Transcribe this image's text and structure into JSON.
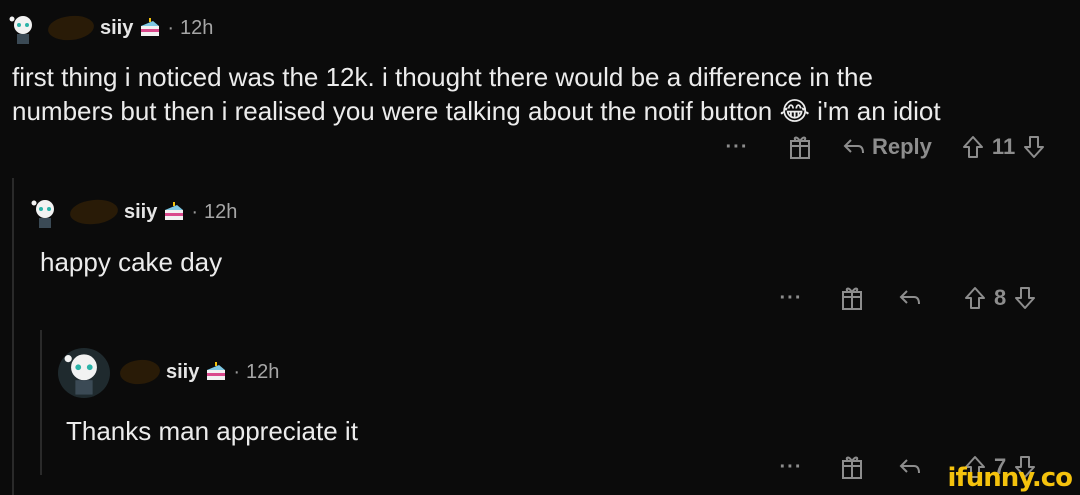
{
  "comments": [
    {
      "username": "siiy",
      "separator": "·",
      "age": "12h",
      "body_line1": "first thing i noticed was the 12k. i thought there would be a difference in the",
      "body_line2": "numbers but then i realised you were talking about the notif button",
      "body_emoji": "😂",
      "body_line2_end": "i'm an idiot",
      "more_label": "···",
      "reply_label": "Reply",
      "votes": "11"
    },
    {
      "username": "siiy",
      "separator": "·",
      "age": "12h",
      "body": "happy cake day",
      "more_label": "···",
      "votes": "8"
    },
    {
      "username": "siiy",
      "separator": "·",
      "age": "12h",
      "body": "Thanks man appreciate it",
      "more_label": "···",
      "votes": "7"
    }
  ],
  "icons": [
    "avatar-icon",
    "cake-day-icon",
    "award-icon",
    "reply-icon",
    "upvote-icon",
    "downvote-icon"
  ],
  "colors": {
    "background": "#0b0b0b",
    "text": "#ececec",
    "muted": "#8d8d8d",
    "watermark": "#f4c20d"
  },
  "watermark": "ifunny.co"
}
